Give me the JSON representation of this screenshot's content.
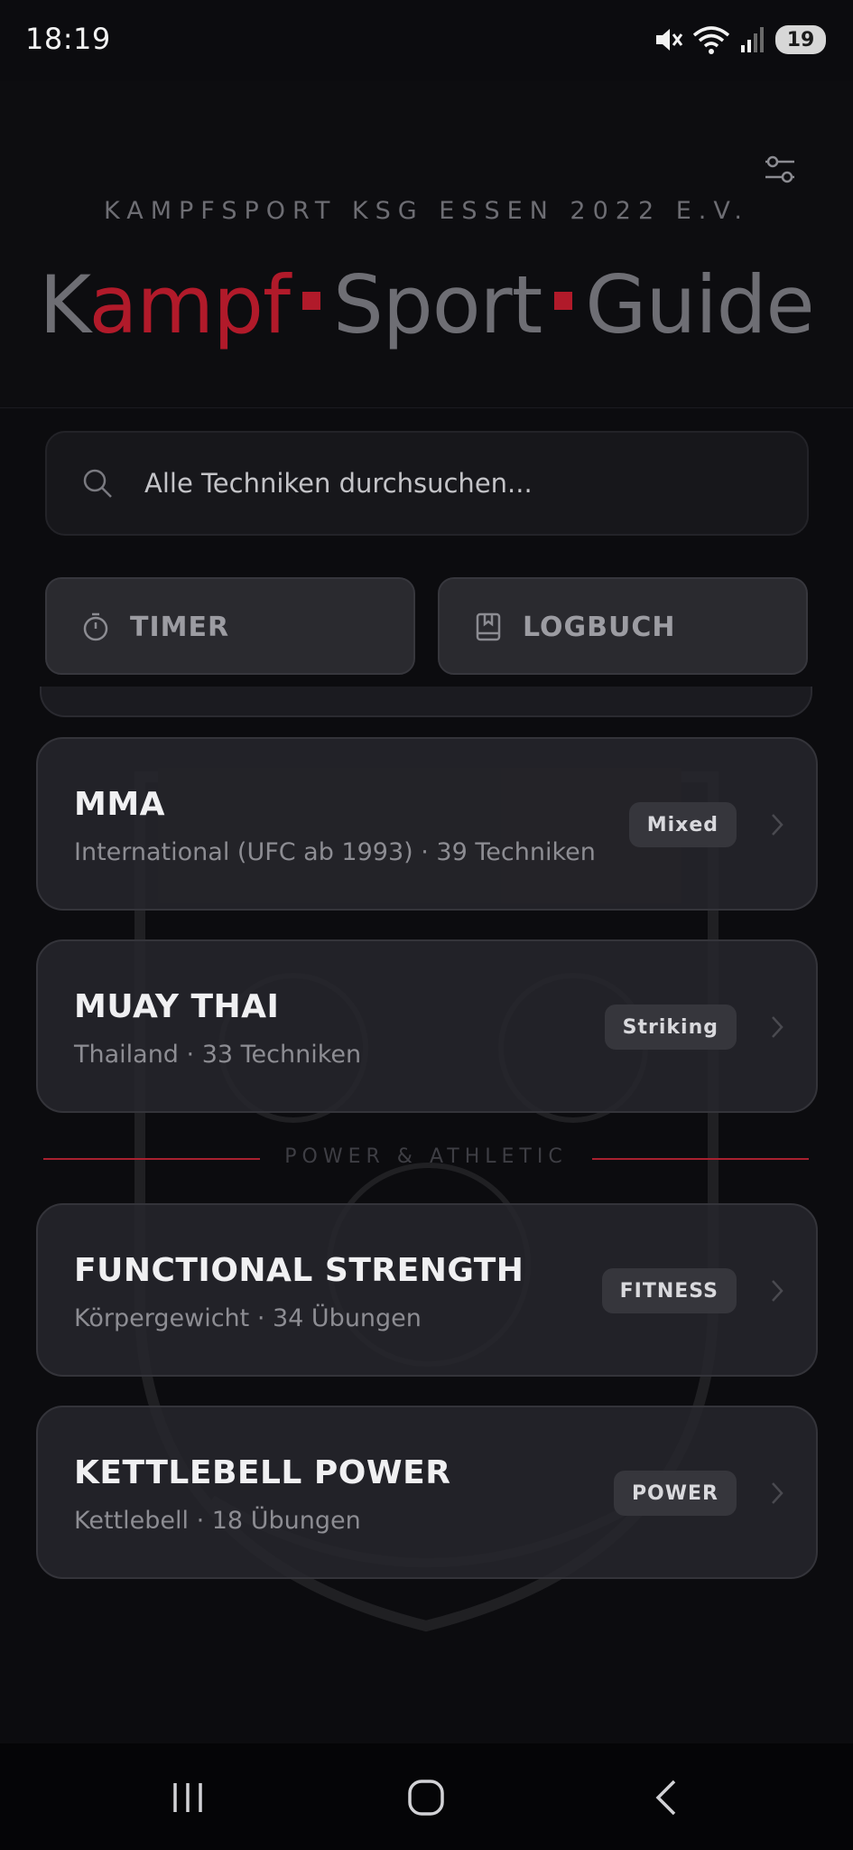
{
  "status_bar": {
    "time": "18:19",
    "battery": "19",
    "icons": [
      "mute-icon",
      "wifi-icon",
      "signal-icon",
      "battery-icon"
    ]
  },
  "header": {
    "club_name": "KAMPFSPORT KSG ESSEN 2022 E.V.",
    "title_parts": [
      "K",
      "ampf",
      "Sport",
      "Guide"
    ],
    "filter_icon": "sliders-icon"
  },
  "search": {
    "placeholder": "Alle Techniken durchsuchen..."
  },
  "actions": {
    "timer_label": "TIMER",
    "logbuch_label": "LOGBUCH"
  },
  "sports": [
    {
      "title": "MMA",
      "subtitle": "International (UFC ab 1993) · 39 Techniken",
      "badge": "Mixed"
    },
    {
      "title": "MUAY THAI",
      "subtitle": "Thailand · 33 Techniken",
      "badge": "Striking"
    }
  ],
  "section": {
    "label": "POWER & ATHLETIC"
  },
  "fitness": [
    {
      "title": "FUNCTIONAL STRENGTH",
      "subtitle": "Körpergewicht · 34 Übungen",
      "badge": "FITNESS"
    },
    {
      "title": "KETTLEBELL POWER",
      "subtitle": "Kettlebell · 18 Übungen",
      "badge": "POWER"
    }
  ],
  "colors": {
    "accent_red": "#b11a2a",
    "background": "#0c0c0f",
    "card": "#26262c"
  }
}
